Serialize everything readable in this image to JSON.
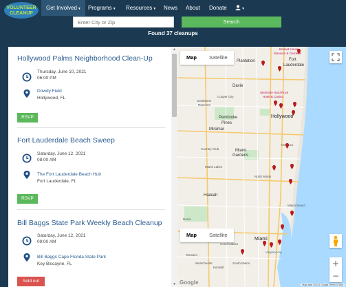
{
  "nav": {
    "logo_text": "VOLUNTEER CLEANUP",
    "items": [
      {
        "label": "Get Involved",
        "caret": "▾"
      },
      {
        "label": "Programs",
        "caret": "▾"
      },
      {
        "label": "Resources",
        "caret": "▾"
      },
      {
        "label": "News"
      },
      {
        "label": "About"
      },
      {
        "label": "Donate"
      }
    ],
    "user_caret": "▾"
  },
  "search": {
    "placeholder": "Enter City or Zip",
    "button_label": "Search",
    "results_text": "Found 37 cleanups"
  },
  "events": [
    {
      "title": "Hollywood Palms Neighborhood Clean-Up",
      "date": "Thursday, June 10, 2021",
      "time": "06:00 PM",
      "venue": "Dowdy Field",
      "city": "Hollywood, FL",
      "action": "RSVP"
    },
    {
      "title": "Fort Lauderdale Beach Sweep",
      "date": "Saturday, June 12, 2021",
      "time": "08:00 AM",
      "venue": "The Fort Lauderdale Beach Hub",
      "city": "Fort Lauderdale, FL",
      "action": "RSVP"
    },
    {
      "title": "Bill Baggs State Park Weekly Beach Cleanup",
      "date": "Saturday, June 12, 2021",
      "time": "09:00 AM",
      "venue": "Bill Baggs Cape Florida State Park",
      "city": "Key Biscayne, FL",
      "action": "Sold out"
    }
  ],
  "map": {
    "toggle": [
      "Map",
      "Satellite"
    ],
    "zoom_in": "+",
    "zoom_out": "−",
    "google": "Google",
    "attribution": "Map data ©2021 Google   Terms of Use",
    "labels": {
      "plantation": "Plantation",
      "fort": "Fort",
      "lauderdale": "Lauderdale",
      "bonnet": "Bonnet House",
      "bonnet2": "Museum & Gardens",
      "davie": "Davie",
      "cooper": "Cooper City",
      "seminole": "Seminole Hard Rock",
      "seminole2": "Hotel & Casino",
      "hollywood": "Hollywood",
      "southwest": "Southwest",
      "ranches": "Ranches",
      "pembroke": "Pembroke",
      "pines": "Pines",
      "miramar": "Miramar",
      "country": "Country Club",
      "miami_gardens": "Miami",
      "gardens": "Gardens",
      "aventura": "Aventura",
      "miami_lakes": "Miami Lakes",
      "north_miami": "North Miami",
      "miami_beach": "Miami Beach",
      "hialeah": "Hialeah",
      "doral": "Doral",
      "miami": "Miami",
      "coral": "Coral Gables",
      "virginia": "Virginia Key",
      "tamiami": "Tamiami",
      "kendall": "Kendall",
      "south_miami": "South Miami",
      "dolphin": "Dolphin Mall",
      "westchester": "Westchester"
    }
  },
  "colors": {
    "nav_bg": "#1b3a52",
    "accent_green": "#5cb85c",
    "sold_out_red": "#d9534f",
    "link_blue": "#2b5d91",
    "pin_red": "#b71c1c"
  }
}
